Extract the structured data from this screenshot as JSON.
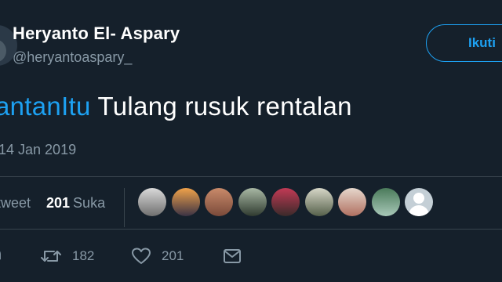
{
  "user": {
    "display_name": "Heryanto El- Aspary",
    "handle": "@heryantoaspary_"
  },
  "follow_button": {
    "label": "Ikuti"
  },
  "tweet": {
    "hashtag": "antanItu",
    "text": " Tulang rusuk rentalan",
    "timestamp": "14 Jan 2019"
  },
  "stats": {
    "retweet_label": "tweet",
    "likes_count": "201",
    "likes_label": "Suka"
  },
  "likers": [
    {
      "name": "liker-avatar-1",
      "colors": [
        "#d9d9d9",
        "#6f6f6f"
      ]
    },
    {
      "name": "liker-avatar-2",
      "colors": [
        "#f0a24a",
        "#3b3244"
      ]
    },
    {
      "name": "liker-avatar-3",
      "colors": [
        "#c98a6a",
        "#7a4a3a"
      ]
    },
    {
      "name": "liker-avatar-4",
      "colors": [
        "#a8b8a4",
        "#2f3a2f"
      ]
    },
    {
      "name": "liker-avatar-5",
      "colors": [
        "#c23a55",
        "#3a2a2a"
      ]
    },
    {
      "name": "liker-avatar-6",
      "colors": [
        "#d7d7c8",
        "#55604a"
      ]
    },
    {
      "name": "liker-avatar-7",
      "colors": [
        "#e6d7cc",
        "#b07060"
      ]
    },
    {
      "name": "liker-avatar-8",
      "colors": [
        "#4a7a5a",
        "#a8c8b8"
      ]
    },
    {
      "name": "liker-avatar-default",
      "colors": [
        "#c4cfd6",
        "#ffffff"
      ]
    }
  ],
  "actions": {
    "retweet_count": "182",
    "like_count": "201"
  },
  "colors": {
    "background": "#15202b",
    "accent": "#1da1f2",
    "secondary_text": "#8899a6",
    "divider": "#38444d"
  }
}
